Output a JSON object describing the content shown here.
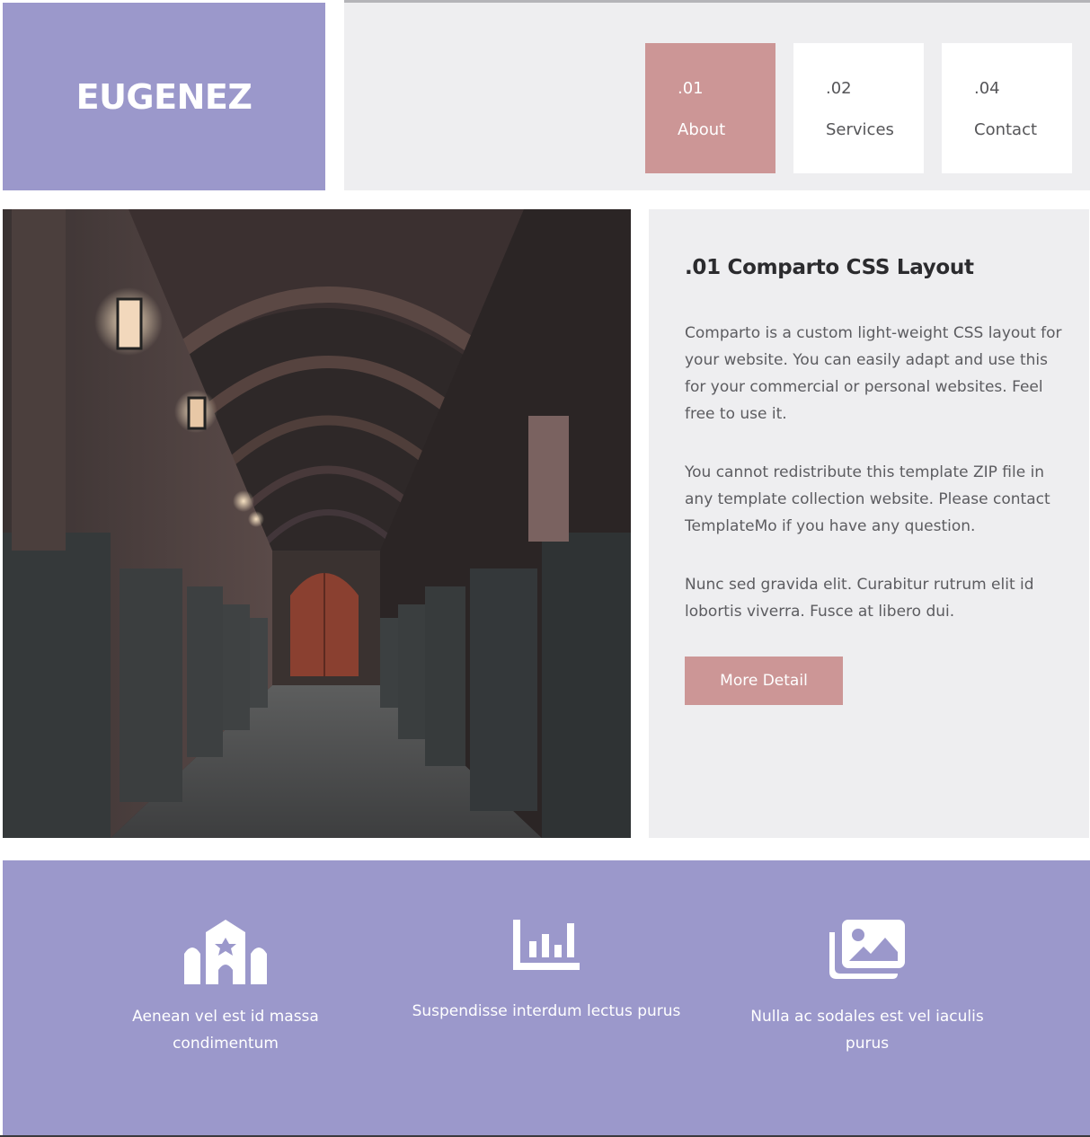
{
  "brand": {
    "logo": "EUGENEZ"
  },
  "nav": {
    "items": [
      {
        "number": ".01",
        "label": "About",
        "active": true
      },
      {
        "number": ".02",
        "label": "Services",
        "active": false
      },
      {
        "number": ".04",
        "label": "Contact",
        "active": false
      }
    ]
  },
  "hero": {
    "image": "arched-corridor-photo"
  },
  "content": {
    "title": ".01 Comparto CSS Layout",
    "paragraphs": [
      "Comparto is a custom light-weight CSS layout for your website. You can easily adapt and use this for your commercial or personal websites. Feel free to use it.",
      "You cannot redistribute this template ZIP file in any template collection website. Please contact TemplateMo if you have any question.",
      "Nunc sed gravida elit. Curabitur rutrum elit id lobortis viverra. Fusce at libero dui."
    ],
    "button_label": "More Detail"
  },
  "features": [
    {
      "icon": "synagogue-icon",
      "text": "Aenean vel est id massa condimentum"
    },
    {
      "icon": "chart-bar-icon",
      "text": "Suspendisse interdum lectus purus"
    },
    {
      "icon": "images-icon",
      "text": "Nulla ac sodales est vel iaculis purus"
    }
  ],
  "colors": {
    "brand_purple": "#9b98cb",
    "accent_rose": "#cc9696",
    "panel_gray": "#eeeef0"
  }
}
